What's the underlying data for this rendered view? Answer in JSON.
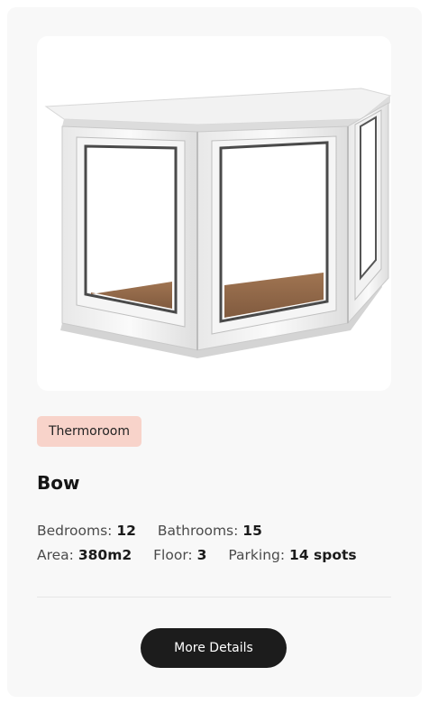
{
  "product": {
    "image_alt": "bow window",
    "tag": "Thermoroom",
    "title": "Bow"
  },
  "specs": {
    "bedrooms_label": "Bedrooms:",
    "bedrooms_value": "12",
    "bathrooms_label": "Bathrooms:",
    "bathrooms_value": "15",
    "area_label": "Area:",
    "area_value": "380m2",
    "floor_label": "Floor:",
    "floor_value": "3",
    "parking_label": "Parking:",
    "parking_value": "14 spots"
  },
  "actions": {
    "details_label": "More Details"
  },
  "colors": {
    "card_bg": "#f8f8f8",
    "tag_bg": "#f8d3ca",
    "button_bg": "#1c1c1c",
    "window_floor": "#8a5f3e"
  }
}
